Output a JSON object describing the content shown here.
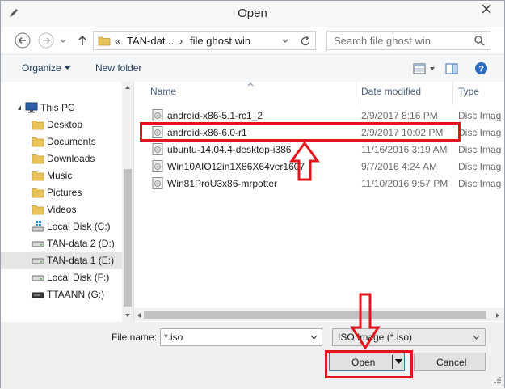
{
  "window": {
    "title": "Open"
  },
  "address": {
    "overflow": "«",
    "segment1": "TAN-dat...",
    "separator": "›",
    "segment2": "file ghost win",
    "search_placeholder": "Search file ghost win"
  },
  "toolbar": {
    "organize": "Organize",
    "new_folder": "New folder"
  },
  "nav": {
    "items": [
      {
        "label": "This PC",
        "icon": "computer-icon"
      },
      {
        "label": "Desktop",
        "icon": "folder-icon"
      },
      {
        "label": "Documents",
        "icon": "folder-icon"
      },
      {
        "label": "Downloads",
        "icon": "folder-icon"
      },
      {
        "label": "Music",
        "icon": "folder-icon"
      },
      {
        "label": "Pictures",
        "icon": "folder-icon"
      },
      {
        "label": "Videos",
        "icon": "folder-icon"
      },
      {
        "label": "Local Disk (C:)",
        "icon": "windows-drive-icon"
      },
      {
        "label": "TAN-data 2 (D:)",
        "icon": "drive-icon"
      },
      {
        "label": "TAN-data 1 (E:)",
        "icon": "drive-icon"
      },
      {
        "label": "Local Disk (F:)",
        "icon": "drive-icon"
      },
      {
        "label": "TTAANN (G:)",
        "icon": "usb-drive-icon"
      }
    ]
  },
  "columns": {
    "name": "Name",
    "date": "Date modified",
    "type": "Type"
  },
  "files": [
    {
      "name": "android-x86-5.1-rc1_2",
      "date": "2/9/2017 8:16 PM",
      "type": "Disc Imag"
    },
    {
      "name": "android-x86-6.0-r1",
      "date": "2/9/2017 10:02 PM",
      "type": "Disc Imag"
    },
    {
      "name": "ubuntu-14.04.4-desktop-i386",
      "date": "11/16/2016 3:19 AM",
      "type": "Disc Imag"
    },
    {
      "name": "Win10AIO12in1X86X64ver1607",
      "date": "9/7/2016 4:24 AM",
      "type": "Disc Imag"
    },
    {
      "name": "Win81ProU3x86-mrpotter",
      "date": "11/10/2016 9:57 PM",
      "type": "Disc Imag"
    }
  ],
  "bottom": {
    "file_name_label": "File name:",
    "file_name_value": "*.iso",
    "file_type": "ISO Image (*.iso)",
    "open_label": "Open",
    "cancel_label": "Cancel"
  },
  "colors": {
    "annotation": "#e3141c",
    "accent": "#1e3a5f"
  }
}
